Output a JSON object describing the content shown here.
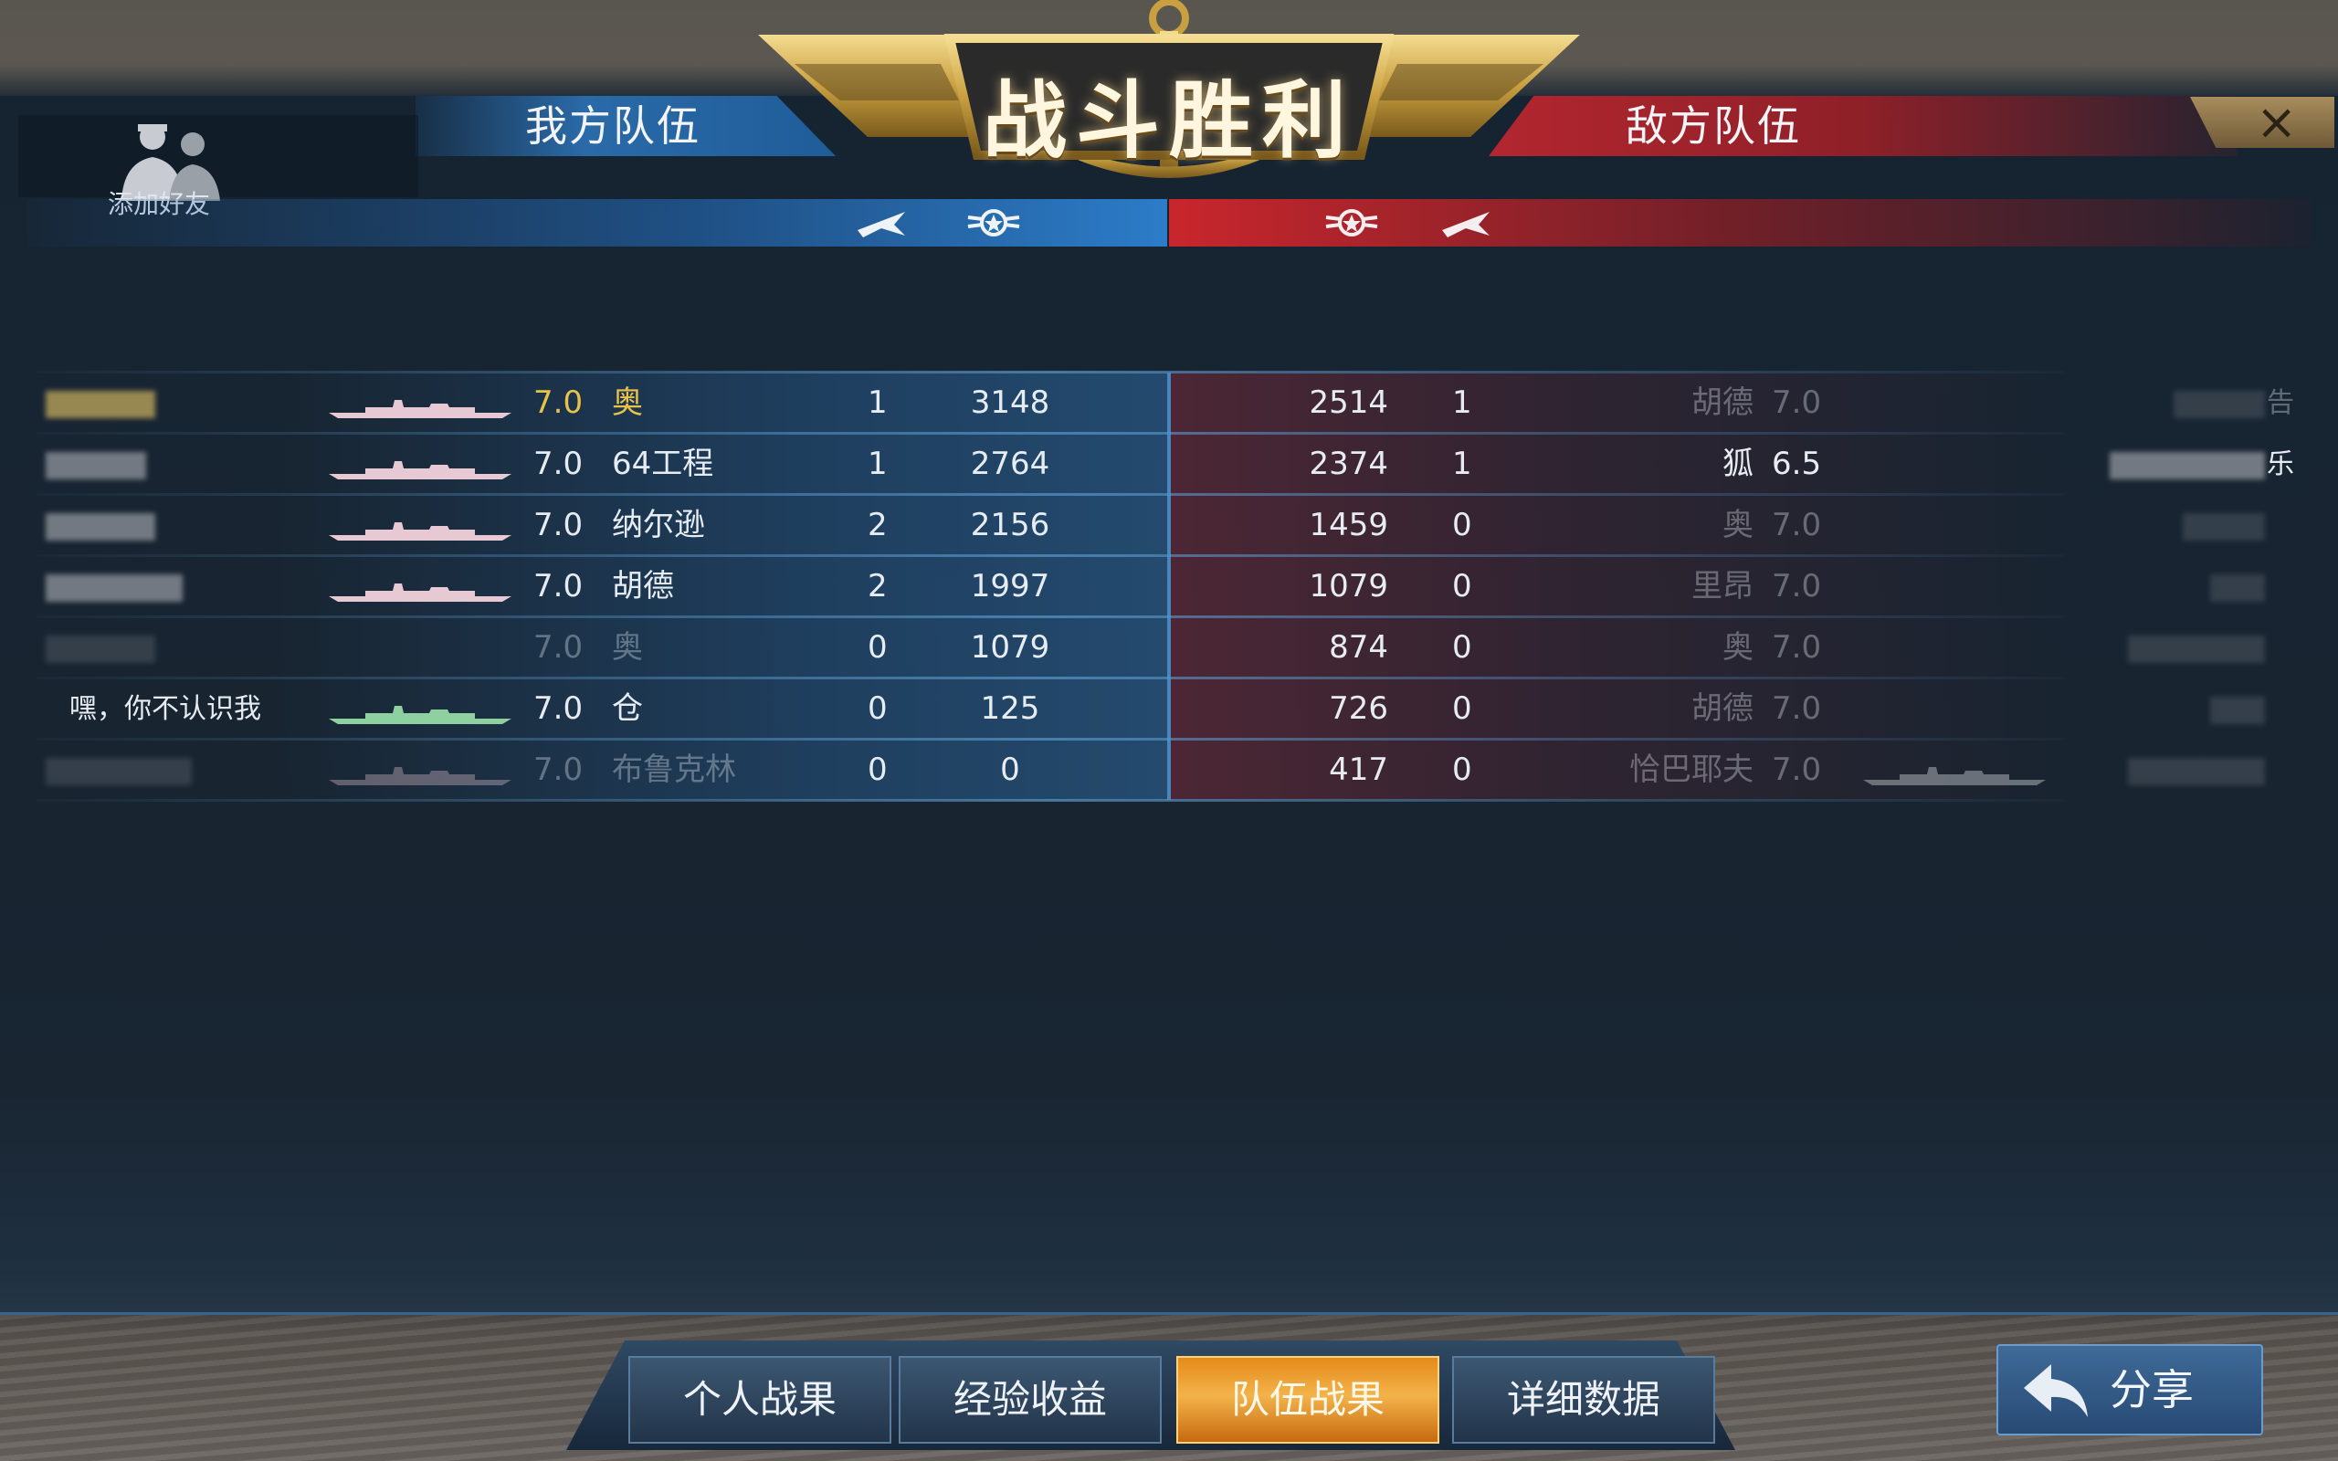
{
  "header": {
    "title": "战斗胜利",
    "ally_team": "我方队伍",
    "enemy_team": "敌方队伍",
    "add_friend": "添加好友",
    "close": "×"
  },
  "ally_rows": [
    {
      "name": "",
      "tier": "7.0",
      "ship": "奥",
      "kills": "1",
      "score": "3148",
      "highlight": true,
      "dim": false
    },
    {
      "name": "",
      "tier": "7.0",
      "ship": "64工程",
      "kills": "1",
      "score": "2764",
      "highlight": false,
      "dim": false
    },
    {
      "name": "",
      "tier": "7.0",
      "ship": "纳尔逊",
      "kills": "2",
      "score": "2156",
      "highlight": false,
      "dim": false
    },
    {
      "name": "",
      "tier": "7.0",
      "ship": "胡德",
      "kills": "2",
      "score": "1997",
      "highlight": false,
      "dim": false
    },
    {
      "name": "",
      "tier": "7.0",
      "ship": "奥",
      "kills": "0",
      "score": "1079",
      "highlight": false,
      "dim": true
    },
    {
      "name": "嘿，你不认识我",
      "tier": "7.0",
      "ship": "仓",
      "kills": "0",
      "score": "125",
      "highlight": false,
      "dim": false
    },
    {
      "name": "",
      "tier": "7.0",
      "ship": "布鲁克林",
      "kills": "0",
      "score": "0",
      "highlight": false,
      "dim": true
    }
  ],
  "enemy_rows": [
    {
      "score": "2514",
      "kills": "1",
      "ship": "胡德",
      "tier": "7.0",
      "name": "告",
      "dim": true
    },
    {
      "score": "2374",
      "kills": "1",
      "ship": "狐",
      "tier": "6.5",
      "name": "乐",
      "dim": false
    },
    {
      "score": "1459",
      "kills": "0",
      "ship": "奥",
      "tier": "7.0",
      "name": "",
      "dim": true
    },
    {
      "score": "1079",
      "kills": "0",
      "ship": "里昂",
      "tier": "7.0",
      "name": "",
      "dim": true
    },
    {
      "score": "874",
      "kills": "0",
      "ship": "奥",
      "tier": "7.0",
      "name": "",
      "dim": true
    },
    {
      "score": "726",
      "kills": "0",
      "ship": "胡德",
      "tier": "7.0",
      "name": "",
      "dim": true
    },
    {
      "score": "417",
      "kills": "0",
      "ship": "恰巴耶夫",
      "tier": "7.0",
      "name": "",
      "dim": true
    }
  ],
  "tabs": [
    {
      "label": "个人战果",
      "active": false
    },
    {
      "label": "经验收益",
      "active": false
    },
    {
      "label": "队伍战果",
      "active": true
    },
    {
      "label": "详细数据",
      "active": false
    }
  ],
  "share": {
    "label": "分享"
  },
  "colors": {
    "ally": "#2a6aa8",
    "enemy": "#b3262f",
    "highlight": "#e8c24a",
    "active_tab": "#e58a1a"
  }
}
